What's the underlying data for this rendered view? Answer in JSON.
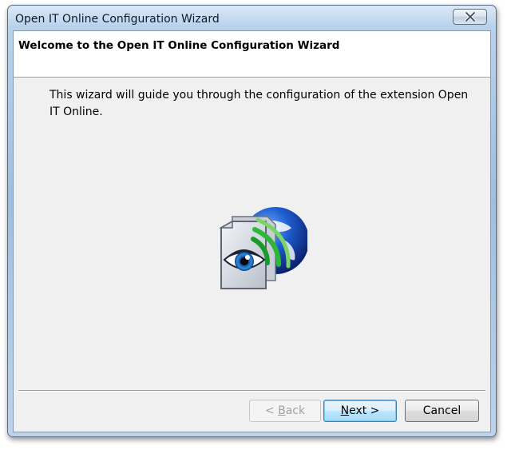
{
  "window": {
    "title": "Open IT Online Configuration Wizard"
  },
  "header": {
    "title": "Welcome to the Open IT Online Configuration Wizard"
  },
  "body": {
    "message": "This wizard will guide you through the configuration of the extension Open IT Online."
  },
  "logo": {
    "icon": "eye-globe-logo-icon"
  },
  "buttons": {
    "back_prefix": "< ",
    "back_mnemonic": "B",
    "back_rest": "ack",
    "back_enabled": false,
    "next_mnemonic": "N",
    "next_rest": "ext >",
    "next_default": true,
    "cancel_label": "Cancel"
  },
  "colors": {
    "frame": "#9ebfe2",
    "client_bg": "#f0f0f0",
    "default_button_border": "#3c7fb1"
  }
}
